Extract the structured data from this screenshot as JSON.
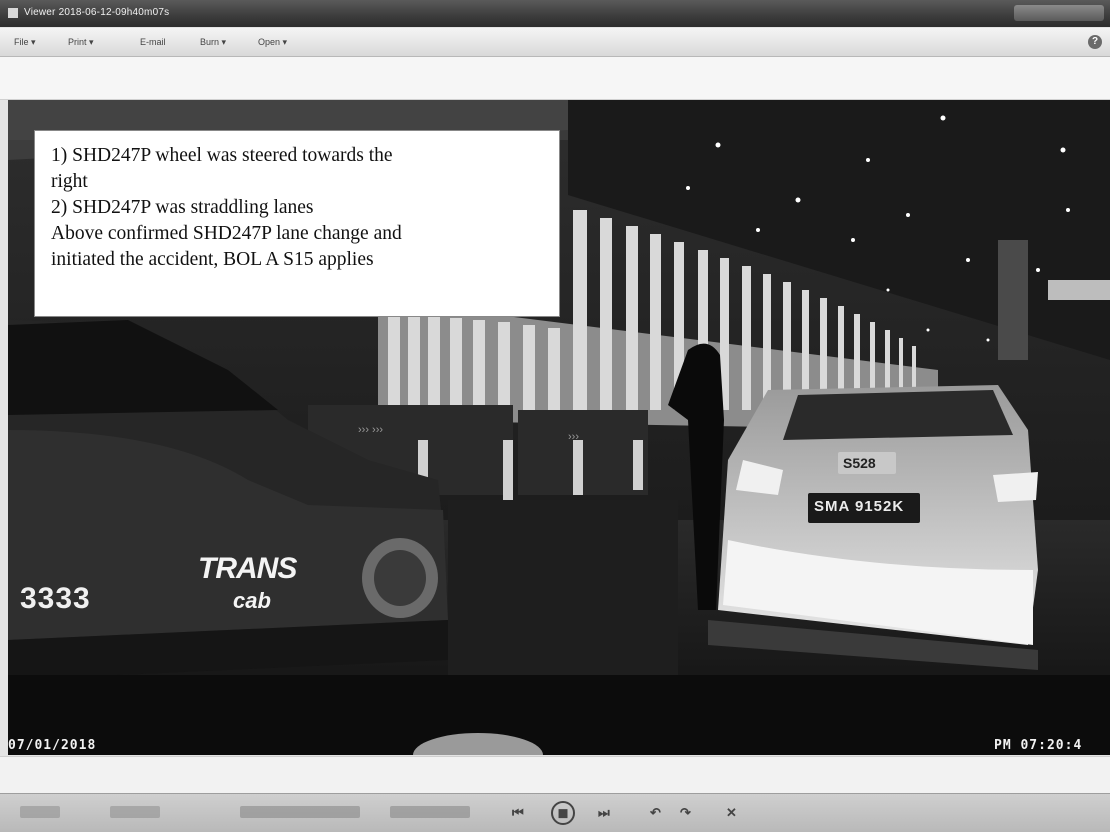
{
  "window": {
    "title": "Viewer 2018-06-12-09h40m07s"
  },
  "menu": {
    "items": [
      "File ▾",
      "Print ▾",
      "E-mail",
      "Burn ▾",
      "Open ▾"
    ],
    "help_glyph": "?"
  },
  "annotation": {
    "line1": "1) SHD247P wheel was steered towards the",
    "line2": "right",
    "line3": "2) SHD247P was straddling lanes",
    "line4": "Above confirmed SHD247P lane change and",
    "line5": "initiated the accident, BOL A S15 applies"
  },
  "video": {
    "date_stamp": "07/01/2018",
    "time_stamp": "PM 07:20:4",
    "taxi_number": "3333",
    "taxi_brand_top": "TRANS",
    "taxi_brand_bottom": "cab",
    "car_plate": "SMA 9152K",
    "car_badge": "S528"
  },
  "playbar": {
    "glyphs": [
      "⏮",
      "◼",
      "⏭",
      "↶",
      "↷",
      "✕"
    ]
  },
  "colors": {
    "titlebar": "#3c3c3c",
    "menubar": "#e0e0e0",
    "video_bg": "#1c1c1c",
    "annotation_bg": "#ffffff"
  }
}
